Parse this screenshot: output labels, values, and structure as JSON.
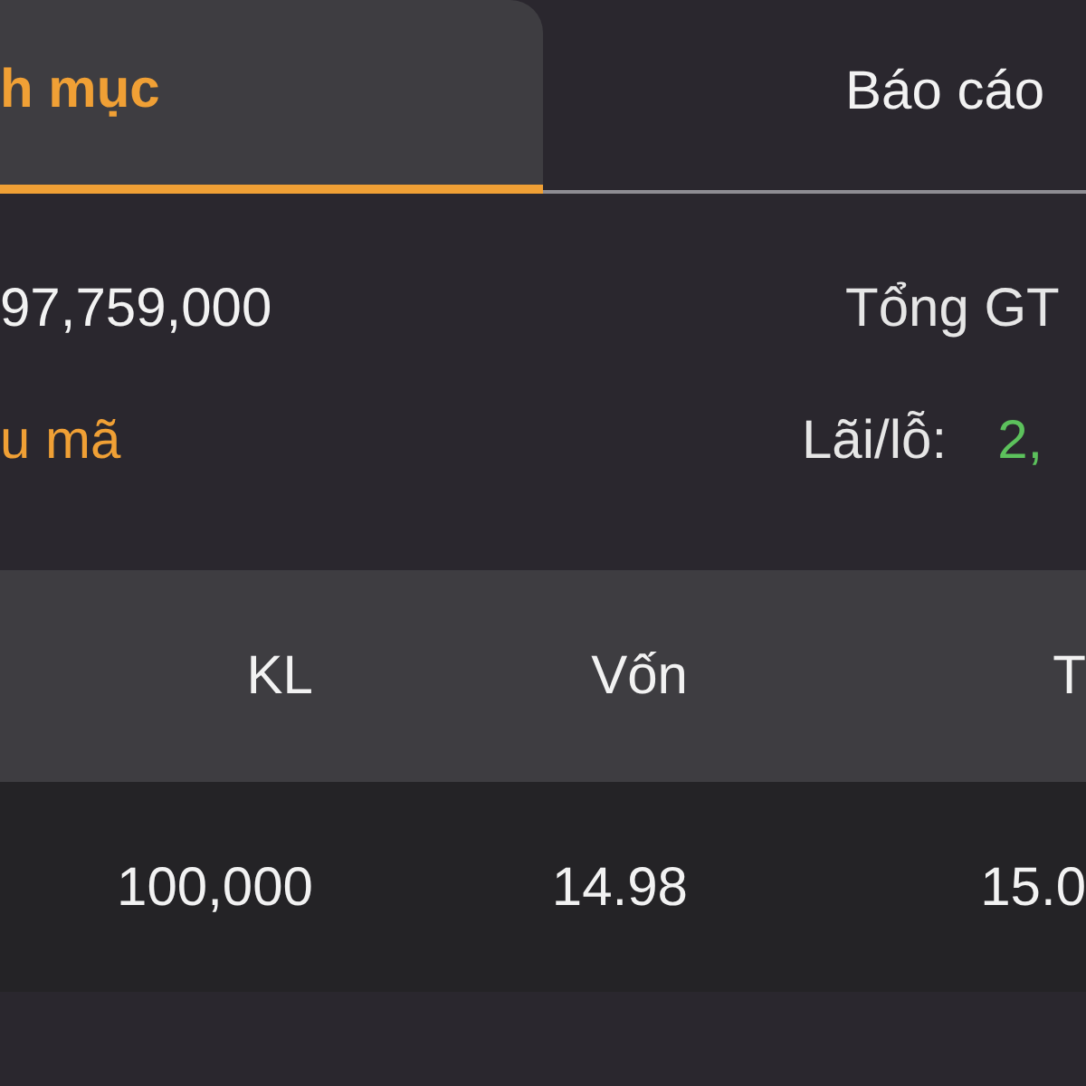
{
  "tabs": [
    {
      "label": "h mục",
      "selected": true
    },
    {
      "label": "Báo cáo",
      "selected": false
    }
  ],
  "summary": {
    "rows": [
      {
        "left": {
          "text": "97,759,000",
          "kind": "value"
        },
        "right": {
          "label": "Tổng GT"
        }
      },
      {
        "left": {
          "text": "u mã",
          "kind": "link"
        },
        "right": {
          "label": "Lãi/lỗ:",
          "value": "2,",
          "positive": true
        }
      }
    ]
  },
  "table": {
    "columns": [
      "KL",
      "Vốn",
      "T"
    ],
    "rows": [
      {
        "cells": [
          "100,000",
          "14.98",
          "15.0"
        ]
      }
    ]
  }
}
